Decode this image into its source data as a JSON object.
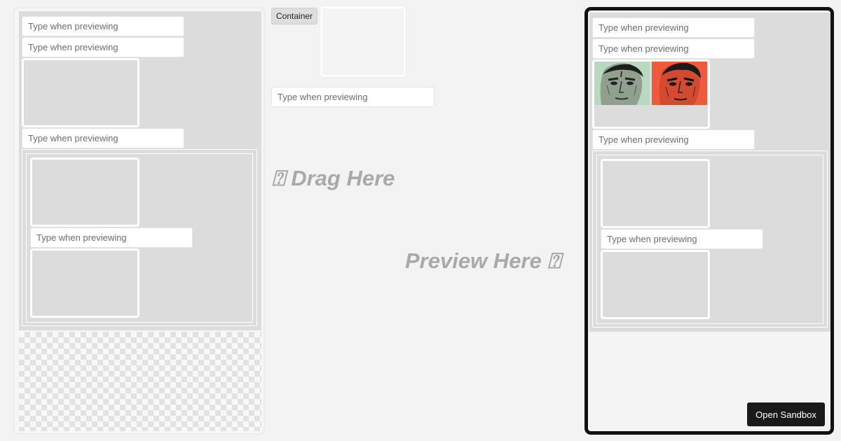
{
  "placeholder": "Type when previewing",
  "palette": {
    "container_label": "Container"
  },
  "hints": {
    "drag": "⍰ Drag Here",
    "preview": "Preview Here ⍰"
  },
  "preview": {
    "open_sandbox_label": "Open Sandbox"
  },
  "images": [
    {
      "icon": "face-portrait-green-icon",
      "tint": "#b9d9bf"
    },
    {
      "icon": "face-portrait-red-icon",
      "tint": "#f05a3c"
    }
  ]
}
